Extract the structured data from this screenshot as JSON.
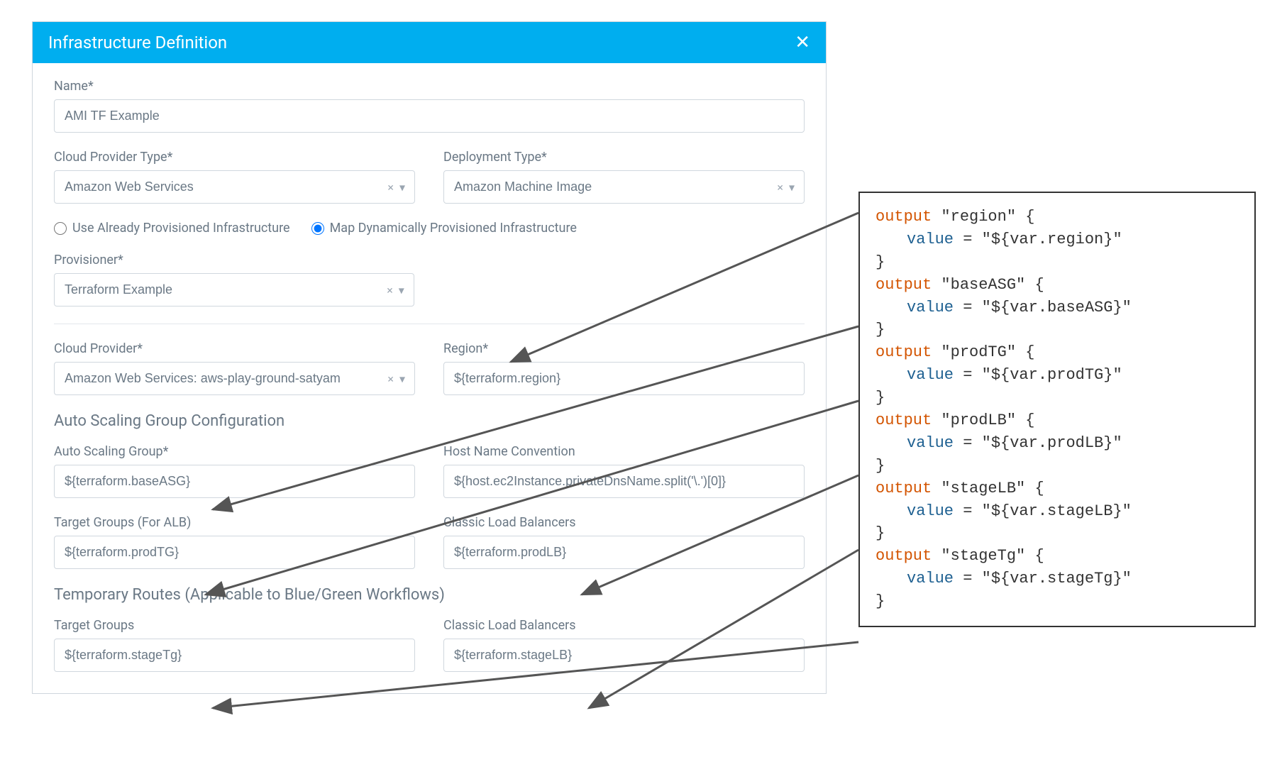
{
  "dialog": {
    "title": "Infrastructure Definition",
    "nameLabel": "Name*",
    "nameValue": "AMI TF Example",
    "cloudProviderTypeLabel": "Cloud Provider Type*",
    "cloudProviderTypeValue": "Amazon Web Services",
    "deploymentTypeLabel": "Deployment Type*",
    "deploymentTypeValue": "Amazon Machine Image",
    "radioExisting": "Use Already Provisioned Infrastructure",
    "radioDynamic": "Map Dynamically Provisioned Infrastructure",
    "provisionerLabel": "Provisioner*",
    "provisionerValue": "Terraform Example",
    "cloudProviderLabel": "Cloud Provider*",
    "cloudProviderValue": "Amazon Web Services: aws-play-ground-satyam",
    "regionLabel": "Region*",
    "regionValue": "${terraform.region}",
    "asgSectionTitle": "Auto Scaling Group Configuration",
    "asgLabel": "Auto Scaling Group*",
    "asgValue": "${terraform.baseASG}",
    "hostNameLabel": "Host Name Convention",
    "hostNameValue": "${host.ec2Instance.privateDnsName.split('\\.')[0]}",
    "tgAlbLabel": "Target Groups (For ALB)",
    "tgAlbValue": "${terraform.prodTG}",
    "clbLabel": "Classic Load Balancers",
    "clbValue": "${terraform.prodLB}",
    "tempRoutesTitle": "Temporary Routes (Applicable to Blue/Green Workflows)",
    "tgLabel": "Target Groups",
    "tgValue": "${terraform.stageTg}",
    "clb2Label": "Classic Load Balancers",
    "clb2Value": "${terraform.stageLB}"
  },
  "code": {
    "outputs": [
      {
        "name": "region",
        "value": "${var.region}"
      },
      {
        "name": "baseASG",
        "value": "${var.baseASG}"
      },
      {
        "name": "prodTG",
        "value": "${var.prodTG}"
      },
      {
        "name": "prodLB",
        "value": "${var.prodLB}"
      },
      {
        "name": "stageLB",
        "value": "${var.stageLB}"
      },
      {
        "name": "stageTg",
        "value": "${var.stageTg}"
      }
    ]
  }
}
